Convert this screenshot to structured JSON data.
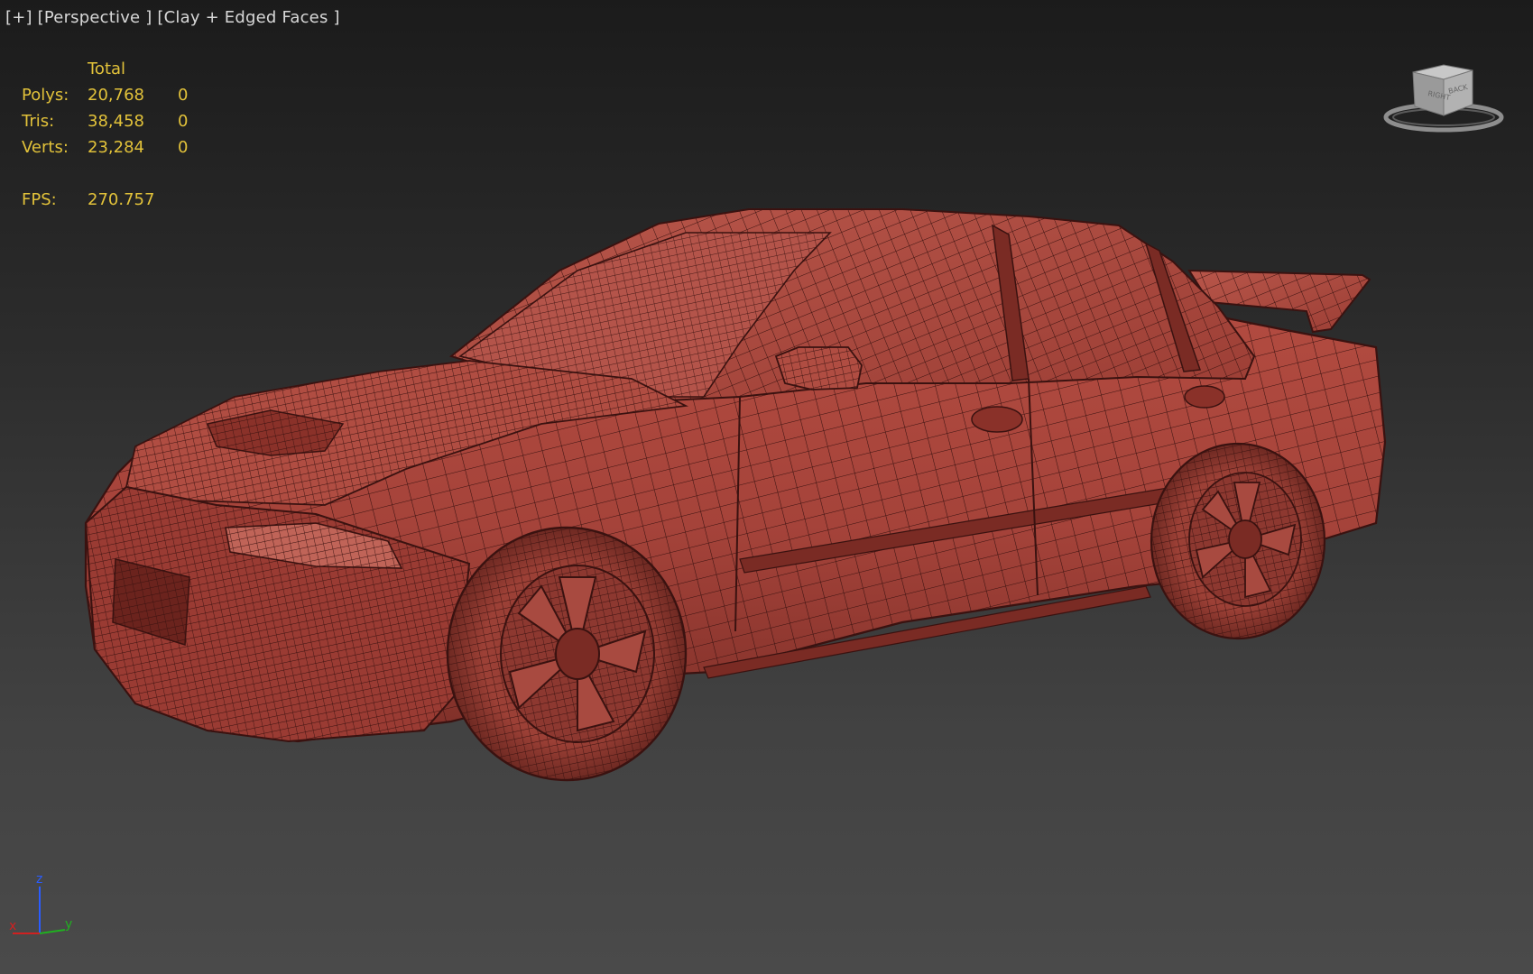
{
  "viewport": {
    "menu_label": "[+]",
    "view_label": "[Perspective ]",
    "shading_label": "[Clay + Edged Faces ]"
  },
  "stats": {
    "header": "Total",
    "rows": [
      {
        "label": "Polys:",
        "total": "20,768",
        "selected": "0"
      },
      {
        "label": "Tris:",
        "total": "38,458",
        "selected": "0"
      },
      {
        "label": "Verts:",
        "total": "23,284",
        "selected": "0"
      }
    ],
    "fps_label": "FPS:",
    "fps_value": "270.757"
  },
  "viewcube": {
    "face_left": "RIGHT",
    "face_right": "BACK"
  },
  "axis_tripod": {
    "z": "z",
    "x": "x",
    "y": "y"
  },
  "colors": {
    "stats_text": "#e2c23a",
    "label_text": "#d8d8d8",
    "clay": "#a8443a",
    "wire": "#3a1210",
    "axis_x": "#d02020",
    "axis_y": "#20b020",
    "axis_z": "#2a5cff"
  },
  "icons": [
    "viewcube-icon",
    "axis-tripod-icon"
  ]
}
